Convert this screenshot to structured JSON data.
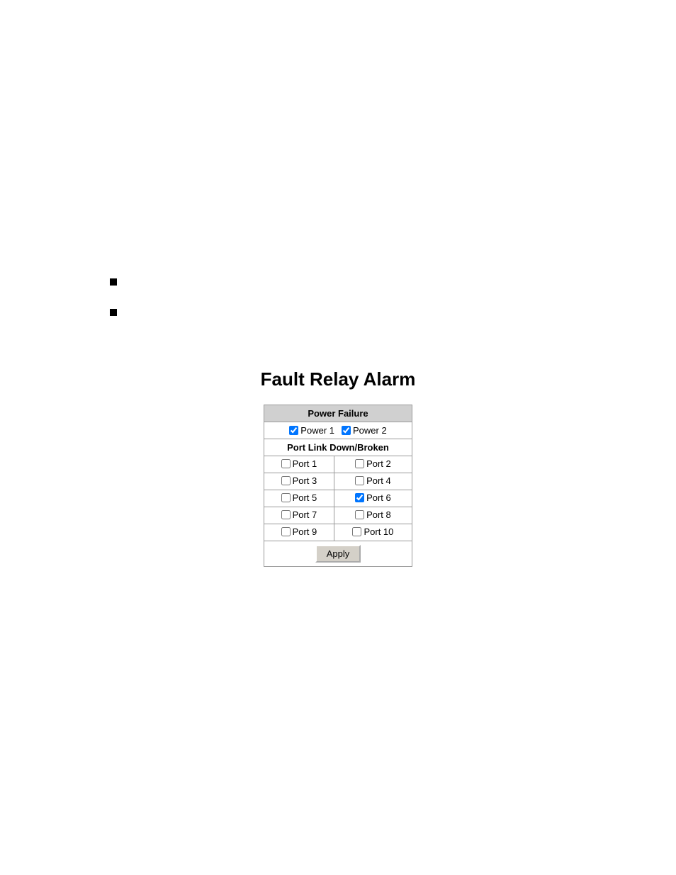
{
  "page": {
    "title": "Fault Relay Alarm",
    "bullets": [
      {
        "id": "bullet1"
      },
      {
        "id": "bullet2"
      }
    ]
  },
  "table": {
    "power_failure_header": "Power Failure",
    "port_link_header": "Port Link Down/Broken",
    "power_row": {
      "power1_label": "Power 1",
      "power1_checked": true,
      "power2_label": "Power 2",
      "power2_checked": true
    },
    "port_rows": [
      {
        "port_a_label": "Port 1",
        "port_a_checked": false,
        "port_b_label": "Port 2",
        "port_b_checked": false
      },
      {
        "port_a_label": "Port 3",
        "port_a_checked": false,
        "port_b_label": "Port 4",
        "port_b_checked": false
      },
      {
        "port_a_label": "Port 5",
        "port_a_checked": false,
        "port_b_label": "Port 6",
        "port_b_checked": true
      },
      {
        "port_a_label": "Port 7",
        "port_a_checked": false,
        "port_b_label": "Port 8",
        "port_b_checked": false
      },
      {
        "port_a_label": "Port 9",
        "port_a_checked": false,
        "port_b_label": "Port 10",
        "port_b_checked": false
      }
    ],
    "apply_label": "Apply"
  }
}
